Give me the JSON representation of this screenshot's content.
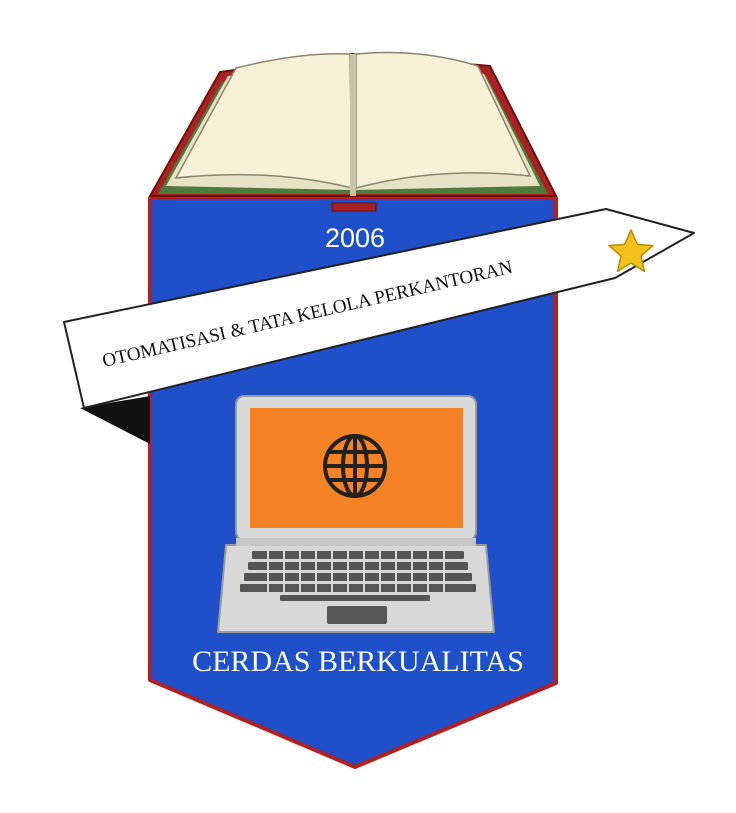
{
  "emblem": {
    "year": "2006",
    "banner_text": "OTOMATISASI & TATA KELOLA PERKANTORAN",
    "motto": "CERDAS BERKUALITAS"
  },
  "colors": {
    "shield_blue": "#1f4fc9",
    "shield_border": "#b42020",
    "book_cover": "#a82222",
    "book_page": "#f6f0d6",
    "book_edge": "#4e7a3c",
    "screen_orange": "#f58224",
    "laptop_body": "#d8d8d8",
    "keyboard_dark": "#555555",
    "star_gold": "#f2c21a",
    "banner_fill": "#ffffff",
    "banner_fold": "#111111",
    "text_white": "#ffffff",
    "text_black": "#111111"
  },
  "icons": {
    "book": "open-book-icon",
    "laptop": "laptop-icon",
    "globe": "globe-icon",
    "star": "star-icon"
  }
}
